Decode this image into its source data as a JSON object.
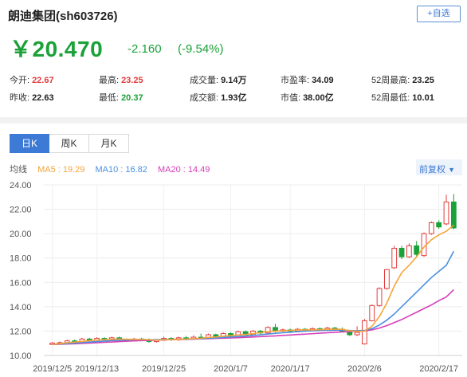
{
  "header": {
    "title": "朗迪集团(sh603726)",
    "follow_label": "+自选"
  },
  "quote": {
    "price": "￥20.470",
    "change": "-2.160",
    "change_pct": "(-9.54%)"
  },
  "stats": [
    {
      "label": "今开:",
      "value": "22.67",
      "color": "#e23c3c"
    },
    {
      "label": "最高:",
      "value": "23.25",
      "color": "#e23c3c"
    },
    {
      "label": "成交量:",
      "value": "9.14万",
      "color": "#222222"
    },
    {
      "label": "市盈率:",
      "value": "34.09",
      "color": "#222222"
    },
    {
      "label": "52周最高:",
      "value": "23.25",
      "color": "#222222"
    },
    {
      "label": "昨收:",
      "value": "22.63",
      "color": "#222222"
    },
    {
      "label": "最低:",
      "value": "20.37",
      "color": "#1aa137"
    },
    {
      "label": "成交额:",
      "value": "1.93亿",
      "color": "#222222"
    },
    {
      "label": "市值:",
      "value": "38.00亿",
      "color": "#222222"
    },
    {
      "label": "52周最低:",
      "value": "10.01",
      "color": "#222222"
    }
  ],
  "tabs": [
    {
      "label": "日K",
      "active": true
    },
    {
      "label": "周K",
      "active": false
    },
    {
      "label": "月K",
      "active": false
    }
  ],
  "ma": {
    "label": "均线",
    "ma5": "MA5 : 19.29",
    "ma10": "MA10 : 16.82",
    "ma20": "MA20 : 14.49",
    "adjust": "前复权"
  },
  "colors": {
    "up": "#e23c3c",
    "down": "#1aa137",
    "ma5": "#f5a43a",
    "ma10": "#4a8fe0",
    "ma20": "#d63fb8",
    "accent": "#3d7ad6"
  },
  "chart_data": {
    "type": "candlestick",
    "ylim": [
      10,
      24
    ],
    "yticks": [
      "24.00",
      "22.00",
      "20.00",
      "18.00",
      "16.00",
      "14.00",
      "12.00",
      "10.00"
    ],
    "x_labels": [
      "2019/12/5",
      "2019/12/13",
      "2019/12/25",
      "2020/1/7",
      "2020/1/17",
      "2020/2/6",
      "2020/2/17"
    ],
    "candles": [
      [
        10.9,
        11.02,
        10.85,
        11.1
      ],
      [
        11.02,
        11.05,
        10.95,
        11.15
      ],
      [
        11.05,
        11.2,
        11.0,
        11.3
      ],
      [
        11.2,
        11.1,
        11.05,
        11.3
      ],
      [
        11.1,
        11.35,
        11.05,
        11.45
      ],
      [
        11.35,
        11.25,
        11.15,
        11.45
      ],
      [
        11.25,
        11.4,
        11.2,
        11.5
      ],
      [
        11.4,
        11.3,
        11.2,
        11.5
      ],
      [
        11.3,
        11.45,
        11.25,
        11.55
      ],
      [
        11.45,
        11.3,
        11.2,
        11.55
      ],
      [
        11.3,
        11.2,
        11.1,
        11.4
      ],
      [
        11.2,
        11.35,
        11.15,
        11.45
      ],
      [
        11.35,
        11.3,
        11.2,
        11.45
      ],
      [
        11.3,
        11.15,
        11.05,
        11.4
      ],
      [
        11.15,
        11.25,
        11.05,
        11.35
      ],
      [
        11.25,
        11.4,
        11.2,
        11.55
      ],
      [
        11.4,
        11.3,
        11.2,
        11.5
      ],
      [
        11.3,
        11.45,
        11.2,
        11.55
      ],
      [
        11.45,
        11.35,
        11.25,
        11.6
      ],
      [
        11.35,
        11.5,
        11.3,
        11.65
      ],
      [
        11.5,
        11.4,
        11.3,
        11.8
      ],
      [
        11.4,
        11.7,
        11.35,
        11.8
      ],
      [
        11.7,
        11.45,
        11.4,
        11.8
      ],
      [
        11.45,
        11.8,
        11.4,
        11.9
      ],
      [
        11.8,
        11.5,
        11.4,
        11.9
      ],
      [
        11.5,
        11.95,
        11.45,
        12.05
      ],
      [
        11.95,
        11.7,
        11.6,
        12.05
      ],
      [
        11.7,
        12.0,
        11.65,
        12.1
      ],
      [
        12.0,
        11.85,
        11.75,
        12.1
      ],
      [
        11.85,
        12.3,
        11.8,
        12.4
      ],
      [
        12.3,
        12.0,
        11.9,
        12.6
      ],
      [
        12.0,
        12.1,
        11.95,
        12.2
      ],
      [
        12.1,
        12.0,
        11.9,
        12.2
      ],
      [
        12.0,
        12.15,
        11.95,
        12.25
      ],
      [
        12.15,
        12.05,
        11.95,
        12.25
      ],
      [
        12.05,
        12.2,
        12.0,
        12.3
      ],
      [
        12.2,
        12.1,
        12.0,
        12.3
      ],
      [
        12.1,
        12.25,
        12.05,
        12.35
      ],
      [
        12.25,
        12.15,
        12.05,
        12.35
      ],
      [
        12.15,
        12.0,
        11.9,
        12.3
      ],
      [
        12.0,
        11.7,
        11.6,
        12.1
      ],
      [
        11.7,
        11.9,
        11.6,
        12.4
      ],
      [
        10.95,
        12.85,
        10.9,
        13.0
      ],
      [
        12.85,
        14.1,
        12.8,
        14.2
      ],
      [
        14.1,
        15.5,
        14.0,
        15.6
      ],
      [
        15.5,
        17.05,
        15.4,
        17.1
      ],
      [
        17.2,
        18.8,
        17.1,
        19.0
      ],
      [
        18.8,
        18.1,
        17.9,
        19.0
      ],
      [
        18.1,
        19.0,
        18.0,
        19.2
      ],
      [
        19.0,
        18.3,
        18.1,
        19.4
      ],
      [
        18.2,
        20.0,
        18.1,
        20.1
      ],
      [
        20.0,
        20.9,
        19.9,
        21.0
      ],
      [
        20.9,
        20.55,
        20.4,
        21.1
      ],
      [
        20.8,
        22.6,
        20.7,
        23.2
      ],
      [
        22.6,
        20.47,
        20.37,
        23.25
      ]
    ],
    "ma5": [
      10.9,
      10.97,
      11.05,
      11.1,
      11.15,
      11.22,
      11.26,
      11.3,
      11.33,
      11.35,
      11.33,
      11.32,
      11.31,
      11.3,
      11.26,
      11.29,
      11.31,
      11.33,
      11.35,
      11.38,
      11.41,
      11.48,
      11.52,
      11.58,
      11.63,
      11.68,
      11.72,
      11.8,
      11.88,
      11.97,
      12.0,
      12.03,
      12.06,
      12.1,
      12.1,
      12.1,
      12.12,
      12.14,
      12.16,
      12.15,
      12.03,
      11.98,
      12.0,
      12.4,
      13.2,
      14.3,
      15.7,
      16.8,
      17.4,
      18.1,
      18.9,
      19.5,
      19.9,
      20.2,
      20.7
    ],
    "ma10": [
      10.9,
      10.94,
      10.98,
      11.02,
      11.06,
      11.1,
      11.14,
      11.18,
      11.22,
      11.25,
      11.27,
      11.29,
      11.3,
      11.3,
      11.3,
      11.31,
      11.32,
      11.33,
      11.34,
      11.36,
      11.38,
      11.41,
      11.44,
      11.48,
      11.52,
      11.56,
      11.6,
      11.65,
      11.7,
      11.76,
      11.82,
      11.87,
      11.91,
      11.96,
      12.0,
      12.03,
      12.05,
      12.07,
      12.08,
      12.08,
      12.05,
      12.03,
      12.06,
      12.2,
      12.5,
      12.9,
      13.4,
      14.0,
      14.6,
      15.2,
      15.8,
      16.4,
      16.9,
      17.4,
      18.55
    ],
    "ma20": [
      10.9,
      10.92,
      10.94,
      10.96,
      10.99,
      11.02,
      11.05,
      11.08,
      11.11,
      11.14,
      11.17,
      11.2,
      11.22,
      11.24,
      11.26,
      11.28,
      11.3,
      11.31,
      11.32,
      11.34,
      11.36,
      11.38,
      11.4,
      11.42,
      11.44,
      11.46,
      11.49,
      11.52,
      11.55,
      11.58,
      11.61,
      11.65,
      11.68,
      11.72,
      11.75,
      11.79,
      11.83,
      11.87,
      11.9,
      11.93,
      11.96,
      11.99,
      12.02,
      12.1,
      12.25,
      12.45,
      12.7,
      12.95,
      13.25,
      13.55,
      13.85,
      14.15,
      14.5,
      14.8,
      15.4
    ]
  }
}
